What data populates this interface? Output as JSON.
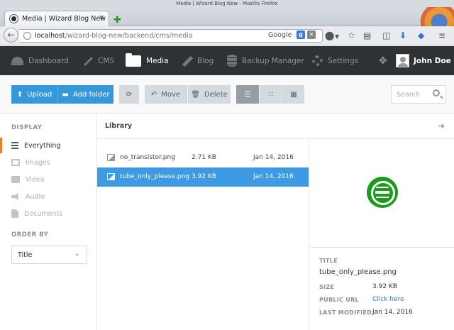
{
  "window": {
    "title": "Media | Wizard Blog New - Mozilla Firefox"
  },
  "browser": {
    "tab_title": "Media | Wizard Blog New",
    "url_host": "localhost",
    "url_path": "/wizard-blog-new/backend/cms/media",
    "search_engine": "Google"
  },
  "appnav": {
    "items": [
      {
        "label": "Dashboard",
        "icon": "dashboard-icon"
      },
      {
        "label": "CMS",
        "icon": "magic-wand-icon"
      },
      {
        "label": "Media",
        "icon": "folder-icon",
        "active": true
      },
      {
        "label": "Blog",
        "icon": "pencil-icon"
      },
      {
        "label": "Backup Manager",
        "icon": "database-icon"
      },
      {
        "label": "Settings",
        "icon": "gear-icon"
      }
    ],
    "user_name": "John Doe"
  },
  "toolbar": {
    "upload": "Upload",
    "add_folder": "Add folder",
    "move": "Move",
    "delete": "Delete",
    "search_placeholder": "Search"
  },
  "sidebar": {
    "display_heading": "DISPLAY",
    "items": [
      {
        "label": "Everything",
        "active": true
      },
      {
        "label": "Images"
      },
      {
        "label": "Video"
      },
      {
        "label": "Audio"
      },
      {
        "label": "Documents"
      }
    ],
    "order_heading": "ORDER BY",
    "order_value": "Title"
  },
  "library": {
    "title": "Library",
    "files": [
      {
        "name": "no_transistor.png",
        "size": "2.71 KB",
        "date": "Jan 14, 2016"
      },
      {
        "name": "tube_only_please.png",
        "size": "3.92 KB",
        "date": "Jan 14, 2016",
        "selected": true
      }
    ]
  },
  "preview": {
    "title_label": "TITLE",
    "filename": "tube_only_please.png",
    "size_label": "SIZE",
    "size": "3.92 KB",
    "url_label": "PUBLIC URL",
    "url_link": "Click here",
    "modified_label": "LAST MODIFIED",
    "modified": "Jan 14, 2016"
  },
  "colors": {
    "accent_blue": "#3498db",
    "selected_row": "#3d9ae3",
    "active_sidebar": "#e67e22",
    "header_bg": "#2f3235",
    "preview_image": "#1a9a1f"
  }
}
